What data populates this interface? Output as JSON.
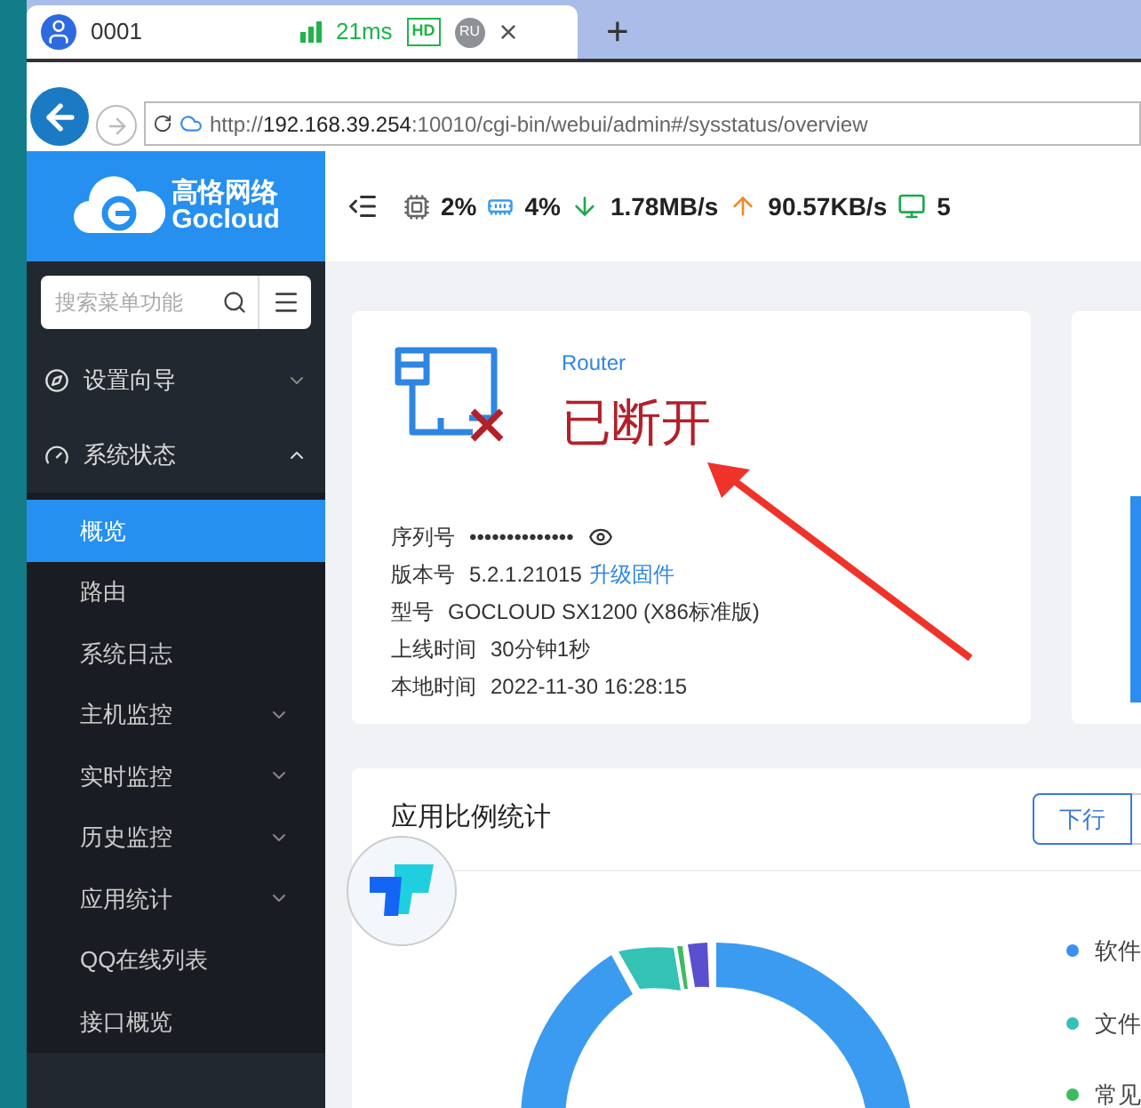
{
  "browser_tab": {
    "title": "0001",
    "latency": "21ms",
    "hd_badge": "HD",
    "user_badge": "RU",
    "close": "×",
    "new_tab": "+"
  },
  "address_bar": {
    "scheme": "http://",
    "host": "192.168.39.254",
    "path": ":10010/cgi-bin/webui/admin#/sysstatus/overview"
  },
  "logo": {
    "name": "高恪网络",
    "brand": "Gocloud"
  },
  "sidebar": {
    "search_placeholder": "搜索菜单功能",
    "items": [
      {
        "label": "设置向导",
        "expanded": false
      },
      {
        "label": "系统状态",
        "expanded": true,
        "children": [
          {
            "label": "概览",
            "selected": true,
            "has_submenu": false
          },
          {
            "label": "路由",
            "selected": false,
            "has_submenu": false
          },
          {
            "label": "系统日志",
            "selected": false,
            "has_submenu": false
          },
          {
            "label": "主机监控",
            "selected": false,
            "has_submenu": true
          },
          {
            "label": "实时监控",
            "selected": false,
            "has_submenu": true
          },
          {
            "label": "历史监控",
            "selected": false,
            "has_submenu": true
          },
          {
            "label": "应用统计",
            "selected": false,
            "has_submenu": true
          },
          {
            "label": "QQ在线列表",
            "selected": false,
            "has_submenu": false
          },
          {
            "label": "接口概览",
            "selected": false,
            "has_submenu": false
          }
        ]
      }
    ]
  },
  "stats": {
    "cpu": "2%",
    "memory": "4%",
    "download": "1.78MB/s",
    "upload": "90.57KB/s",
    "clients": "5"
  },
  "device_card": {
    "type": "Router",
    "status": "已断开",
    "connected": false,
    "fields": [
      {
        "label": "序列号",
        "value": "••••••••••••••",
        "kind": "secret"
      },
      {
        "label": "版本号",
        "value": "5.2.1.21015",
        "link": "升级固件",
        "kind": "link"
      },
      {
        "label": "型号",
        "value": "GOCLOUD SX1200 (X86标准版)",
        "kind": "text"
      },
      {
        "label": "上线时间",
        "value": "30分钟1秒",
        "kind": "text"
      },
      {
        "label": "本地时间",
        "value": "2022-11-30 16:28:15",
        "kind": "text"
      }
    ]
  },
  "app_stats": {
    "title": "应用比例统计",
    "toggle": "下行",
    "legend": [
      {
        "label": "软件",
        "color": "#3b8ff0"
      },
      {
        "label": "文件",
        "color": "#34c2b5"
      },
      {
        "label": "常见",
        "color": "#3dbb61"
      }
    ]
  }
}
